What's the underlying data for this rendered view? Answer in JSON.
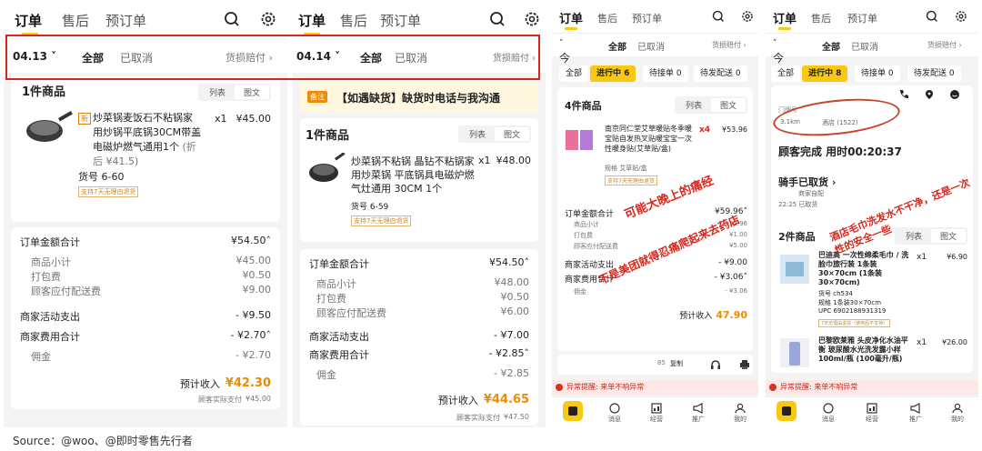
{
  "caption": "Source：@woo、@即时零售先行者",
  "common": {
    "tab_order": "订单",
    "tab_after": "售后",
    "tab_pre": "预订单",
    "all": "全部",
    "cancelled": "已取消",
    "list_view": "列表",
    "image_view": "图文",
    "order_total": "订单金额合计",
    "goods_subtotal": "商品小计",
    "pack_fee": "打包费",
    "delivery_fee": "顾客应付配送费",
    "merchant_activity": "商家活动支出",
    "merchant_fee_total": "商家费用合计",
    "commission": "佣金",
    "est_income": "预计收入",
    "customer_paid": "顾客实际支付",
    "return_tag": "支持7天无理由退货",
    "loss_comp": "货损赔付 ›"
  },
  "panel1": {
    "date": "04.13",
    "goods_count": "1件商品",
    "new_badge": "新",
    "product_name": "炒菜锅麦饭石不粘锅家用炒锅平底锅30CM带盖 电磁炉燃气通用1个",
    "product_extra": "(折后 ¥41.5)",
    "qty": "x1",
    "price": "¥45.00",
    "sku": "货号 6-60",
    "order_total": "¥54.50",
    "goods_subtotal": "¥45.00",
    "pack_fee": "¥0.50",
    "delivery_fee": "¥9.00",
    "merchant_activity": "- ¥9.50",
    "merchant_fee_total": "- ¥2.70",
    "commission": "- ¥2.70",
    "est_income": "¥42.30",
    "customer_paid": "¥45.00"
  },
  "panel2": {
    "date": "04.14",
    "note_badge": "备注",
    "note_text": "【如遇缺货】缺货时电话与我沟通",
    "goods_count": "1件商品",
    "product_name": "炒菜锅不粘锅 晶钻不粘锅家用炒菜锅 平底锅具电磁炉燃气灶通用 30CM 1个",
    "qty": "x1",
    "price": "¥48.00",
    "sku": "货号 6-59",
    "order_total": "¥54.50",
    "goods_subtotal": "¥48.00",
    "pack_fee": "¥0.50",
    "delivery_fee": "¥6.00",
    "merchant_activity": "- ¥7.00",
    "merchant_fee_total": "- ¥2.85",
    "commission": "- ¥2.85",
    "est_income": "¥44.65",
    "customer_paid": "¥47.50"
  },
  "panel3": {
    "date": "今日",
    "chip_all": "全部",
    "chip_inprogress": "进行中 6",
    "chip_toaccept": "待接单 0",
    "chip_todeliver": "待发配送 0",
    "goods_count": "4件商品",
    "product_name": "南京同仁堂艾草暖贴冬季暖宝贴自发热叉贴暖宝宝一次性暖身贴(艾草贴/盒)",
    "product_spec": "规格 艾草贴/盒",
    "qty": "x4",
    "price": "¥53.96",
    "order_total": "¥59.96",
    "goods_subtotal": "¥53.96",
    "pack_fee": "¥1.00",
    "delivery_fee": "¥5.00",
    "merchant_activity": "- ¥9.00",
    "merchant_fee_total": "- ¥3.06",
    "commission": "- ¥3.06",
    "est_income": "47.90",
    "copy_ref": "85",
    "copy_btn": "复制",
    "note1": "可能大晚上的痛经",
    "note2": "不是美团就得忍痛爬起来去药店",
    "warn": "异常提醒: 来单不响异常",
    "nav": [
      "",
      "消息",
      "经营",
      "推广",
      "我的"
    ]
  },
  "panel4": {
    "date": "今日",
    "chip_all": "全部",
    "chip_inprogress": "进行中 8",
    "chip_toaccept": "待接单 0",
    "chip_todeliver": "待发配送 0",
    "address_label": "门牌号",
    "distance": "3.1km",
    "hotel": "酒店 (1522)",
    "delivered": "顾客完成 用时00:20:37",
    "rider": "骑手已取货 ›",
    "rider_detail": "商家自配",
    "rider_time": "22:25 已取货",
    "goods_count": "2件商品",
    "note": "酒店毛巾洗发水不干净，还是一次性的安全一些",
    "item1_name": "巴迪高 一次性绵柔毛巾 / 洗脸巾旅行装 1条装30×70cm (1条装30×70cm)",
    "item1_sku": "货号 ch534",
    "item1_spec": "规格 1条装30×70cm",
    "item1_upc": "UPC 6902188931319",
    "item1_tag": "7天无理由退货（使用后不支持）",
    "item1_qty": "x1",
    "item1_price": "¥6.90",
    "item2_name": "巴黎欧莱雅 头皮净化水油平衡 玻尿酸水光洗发露小样 100ml/瓶 (100毫升/瓶)",
    "item2_qty": "x1",
    "item2_price": "¥26.00",
    "warn": "异常提醒: 来单不响异常",
    "nav": [
      "",
      "消息",
      "经营",
      "推广",
      "我的"
    ]
  },
  "colors": {
    "accent_yellow": "#f8c813",
    "price_orange": "#f08a00",
    "highlight_red": "#d9261c"
  }
}
